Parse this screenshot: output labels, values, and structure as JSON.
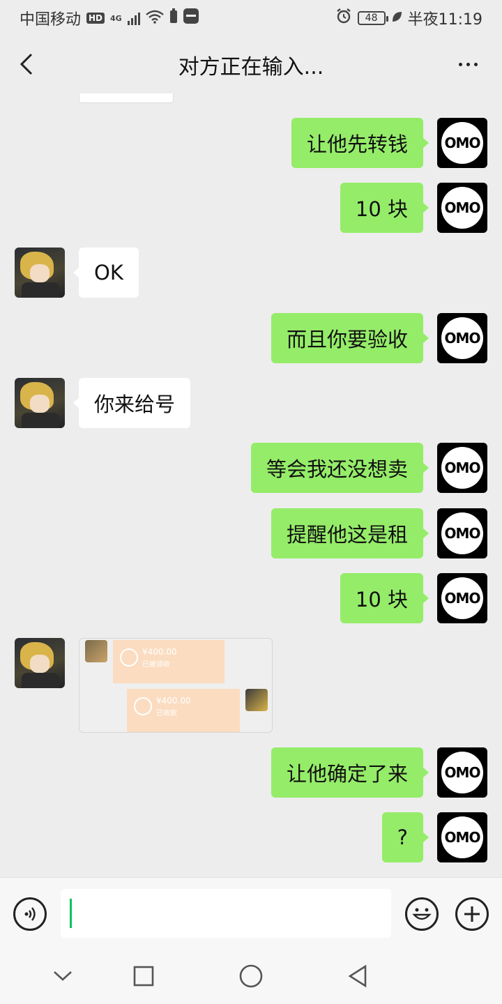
{
  "status_bar": {
    "carrier": "中国移动",
    "hd_badge": "HD",
    "network": "4G",
    "battery": "48",
    "time": "半夜11:19",
    "icons": [
      "hd-icon",
      "signal-icon",
      "wifi-icon",
      "battery-saver-icon",
      "huawei-icon",
      "alarm-icon",
      "battery-icon",
      "leaf-icon"
    ]
  },
  "header": {
    "title": "对方正在输入...",
    "back_icon": "back-chevron-icon",
    "more_icon": "more-dots-icon"
  },
  "avatars": {
    "self": "OMO",
    "other": "anime-avatar"
  },
  "messages": [
    {
      "side": "right",
      "text": "让他先转钱"
    },
    {
      "side": "right",
      "text": "10 块"
    },
    {
      "side": "left",
      "text": "OK"
    },
    {
      "side": "right",
      "text": "而且你要验收"
    },
    {
      "side": "left",
      "text": "你来给号"
    },
    {
      "side": "right",
      "text": "等会我还没想卖"
    },
    {
      "side": "right",
      "text": "提醒他这是租"
    },
    {
      "side": "right",
      "text": "10 块"
    },
    {
      "side": "left",
      "type": "image",
      "payments": [
        {
          "amount": "¥400.00",
          "status": "已被领收"
        },
        {
          "amount": "¥400.00",
          "status": "已收款"
        }
      ]
    },
    {
      "side": "right",
      "text": "让他确定了来"
    },
    {
      "side": "right",
      "text": "?"
    }
  ],
  "input_bar": {
    "voice_icon": "voice-icon",
    "emoji_icon": "emoji-icon",
    "plus_icon": "plus-icon",
    "value": ""
  },
  "nav_bar": {
    "icons": [
      "nav-down-icon",
      "nav-recents-icon",
      "nav-home-icon",
      "nav-back-icon"
    ]
  },
  "colors": {
    "background": "#ededed",
    "sent_bubble": "#95ec69",
    "received_bubble": "#ffffff",
    "caret": "#07c160",
    "payment_card": "#fbdcc0"
  }
}
